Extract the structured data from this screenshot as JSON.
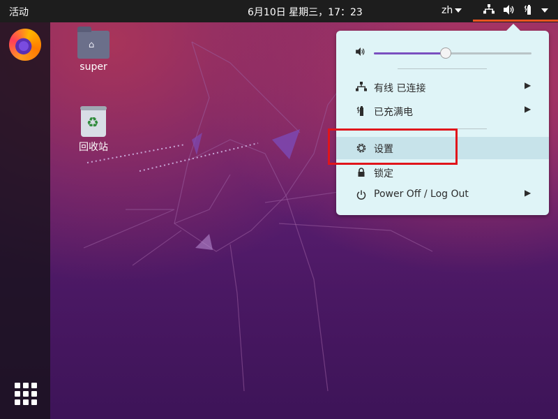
{
  "topbar": {
    "activities": "活动",
    "clock": "6月10日 星期三，17：23",
    "lang": "zh"
  },
  "desktop": {
    "icons": [
      {
        "label": "super",
        "icon": "home-folder-icon"
      },
      {
        "label": "回收站",
        "icon": "trash-recycle-icon"
      }
    ]
  },
  "menu": {
    "volume_percent": 45,
    "items": [
      {
        "icon": "network-wired-icon",
        "label": "有线 已连接",
        "has_submenu": true
      },
      {
        "icon": "battery-full-icon",
        "label": "已充满电",
        "has_submenu": true
      },
      {
        "icon": "gear-icon",
        "label": "设置",
        "has_submenu": false
      },
      {
        "icon": "lock-icon",
        "label": "锁定",
        "has_submenu": false
      },
      {
        "icon": "power-icon",
        "label": "Power Off / Log Out",
        "has_submenu": true
      }
    ]
  },
  "colors": {
    "accent_orange": "#e95420",
    "highlight_red": "#e0151b",
    "slider_purple": "#7a4fbf",
    "menu_bg": "#dff4f7"
  }
}
